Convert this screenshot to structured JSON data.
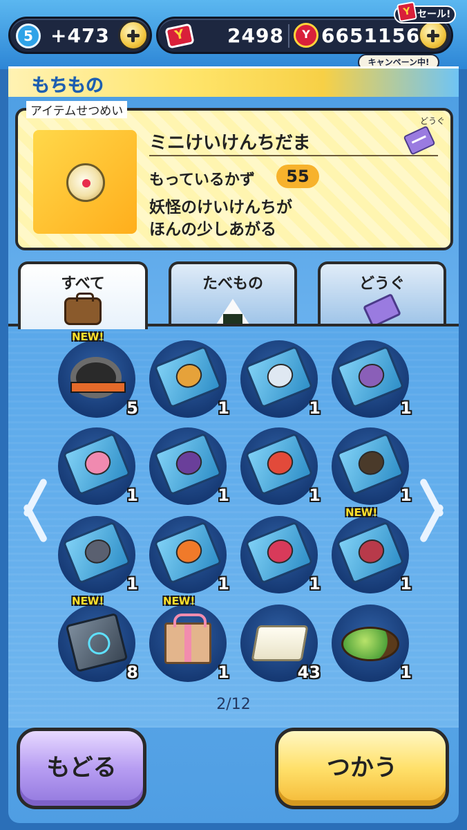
{
  "topbar": {
    "level": "5",
    "bonus": "+473",
    "ymoney": "2498",
    "coins": "6651156",
    "sale_label": "セール!",
    "campaign_label": "キャンペーン中!"
  },
  "header": {
    "title": "もちもの"
  },
  "description": {
    "section_label": "アイテムせつめい",
    "item_name": "ミニけいけんちだま",
    "category": "どうぐ",
    "count_label": "もっているかず",
    "count_value": "55",
    "text_line1": "妖怪のけいけんちが",
    "text_line2": "ほんの少しあがる"
  },
  "tabs": [
    {
      "label": "すべて",
      "icon": "bag-icon"
    },
    {
      "label": "たべもの",
      "icon": "onigiri-icon"
    },
    {
      "label": "どうぐ",
      "icon": "ticket-icon"
    }
  ],
  "grid": {
    "items": [
      {
        "icon": "spiked-bracelet-icon",
        "qty": "5",
        "new": "NEW!"
      },
      {
        "icon": "blue-book-icon",
        "qty": "1",
        "new": ""
      },
      {
        "icon": "blue-book-icon",
        "qty": "1",
        "new": ""
      },
      {
        "icon": "blue-book-icon",
        "qty": "1",
        "new": ""
      },
      {
        "icon": "blue-book-icon",
        "qty": "1",
        "new": ""
      },
      {
        "icon": "blue-book-icon",
        "qty": "1",
        "new": ""
      },
      {
        "icon": "blue-book-icon",
        "qty": "1",
        "new": ""
      },
      {
        "icon": "blue-book-icon",
        "qty": "1",
        "new": ""
      },
      {
        "icon": "blue-book-icon",
        "qty": "1",
        "new": ""
      },
      {
        "icon": "blue-book-icon",
        "qty": "1",
        "new": ""
      },
      {
        "icon": "blue-book-icon",
        "qty": "1",
        "new": ""
      },
      {
        "icon": "blue-book-icon",
        "qty": "1",
        "new": "NEW!"
      },
      {
        "icon": "stone-book-icon",
        "qty": "8",
        "new": "NEW!"
      },
      {
        "icon": "gift-box-icon",
        "qty": "1",
        "new": "NEW!"
      },
      {
        "icon": "tofu-icon",
        "qty": "43",
        "new": ""
      },
      {
        "icon": "salad-icon",
        "qty": "1",
        "new": ""
      }
    ]
  },
  "pager": {
    "text": "2/12"
  },
  "buttons": {
    "back": "もどる",
    "use": "つかう"
  }
}
